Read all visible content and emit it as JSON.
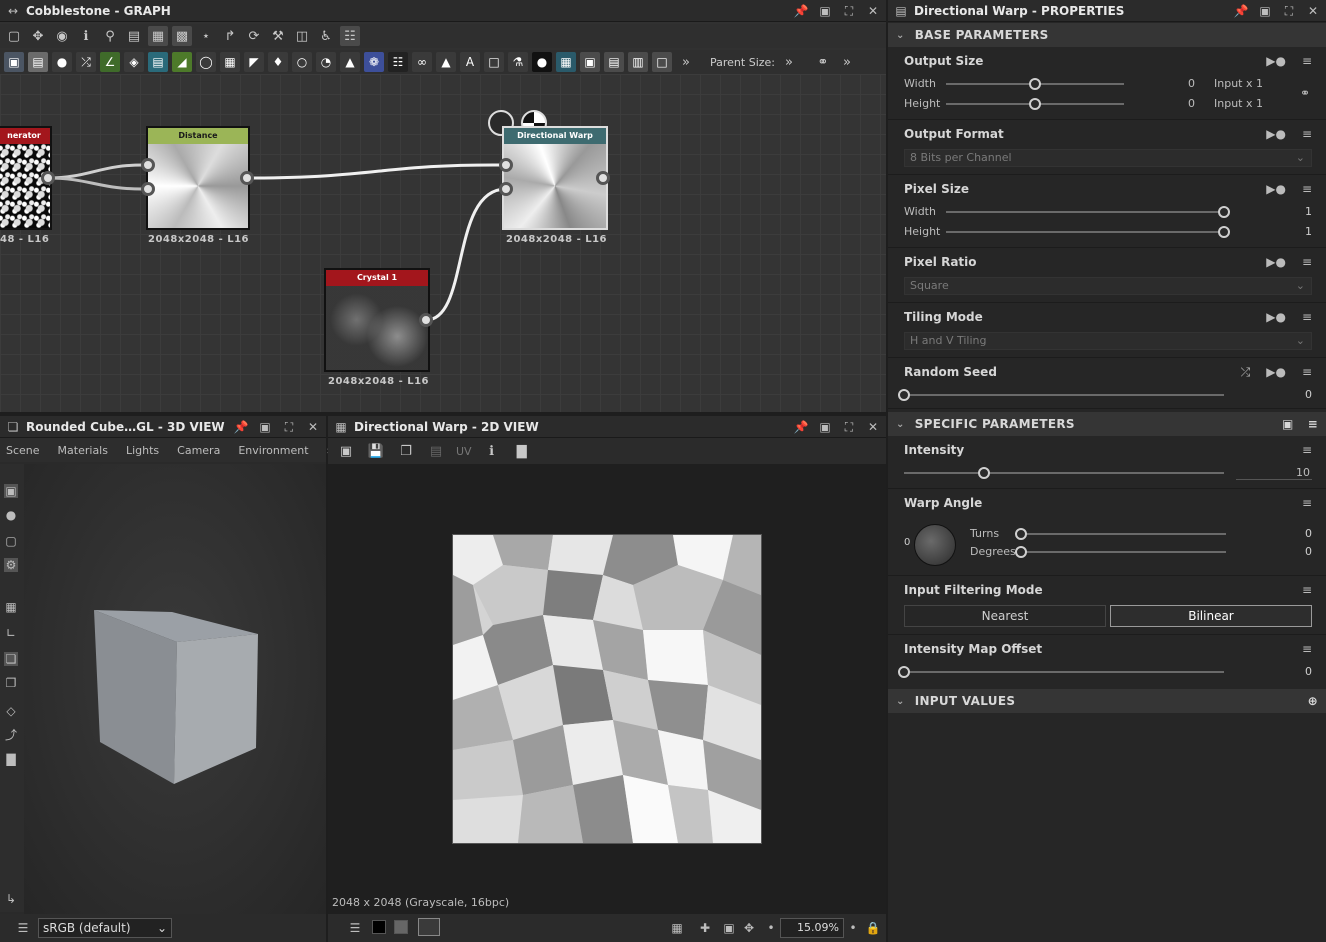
{
  "graph": {
    "title": "Cobblestone - GRAPH",
    "parent_size_label": "Parent Size:",
    "nodes": [
      {
        "id": "generator",
        "header": "nerator",
        "header_color": "#a3161c",
        "size_label": "48 - L16"
      },
      {
        "id": "distance",
        "header": "Distance",
        "header_color": "#9bb557",
        "size_label": "2048x2048 - L16"
      },
      {
        "id": "directional_warp",
        "header": "Directional Warp",
        "header_color": "#3e6b70",
        "size_label": "2048x2048 - L16"
      },
      {
        "id": "crystal",
        "header": "Crystal 1",
        "header_color": "#a3161c",
        "size_label": "2048x2048 - L16"
      }
    ]
  },
  "view3d": {
    "title": "Rounded Cube…GL - 3D VIEW",
    "tabs": [
      "Scene",
      "Materials",
      "Lights",
      "Camera",
      "Environment"
    ],
    "colorspace": "sRGB (default)"
  },
  "view2d": {
    "title": "Directional Warp - 2D VIEW",
    "uv_label": "UV",
    "status": "2048 x 2048 (Grayscale, 16bpc)",
    "zoom": "15.09%"
  },
  "props": {
    "title": "Directional Warp - PROPERTIES",
    "base_section": "BASE PARAMETERS",
    "output_size": {
      "label": "Output Size",
      "width_label": "Width",
      "width_value": "0",
      "width_suffix": "Input x 1",
      "height_label": "Height",
      "height_value": "0",
      "height_suffix": "Input x 1",
      "width_fraction": 0.5,
      "height_fraction": 0.5
    },
    "output_format": {
      "label": "Output Format",
      "value": "8 Bits per Channel"
    },
    "pixel_size": {
      "label": "Pixel Size",
      "width_label": "Width",
      "width_value": "1",
      "height_label": "Height",
      "height_value": "1",
      "width_fraction": 1.0,
      "height_fraction": 1.0
    },
    "pixel_ratio": {
      "label": "Pixel Ratio",
      "value": "Square"
    },
    "tiling_mode": {
      "label": "Tiling Mode",
      "value": "H and V Tiling"
    },
    "random_seed": {
      "label": "Random Seed",
      "value": "0",
      "fraction": 0.0
    },
    "specific_section": "SPECIFIC PARAMETERS",
    "intensity": {
      "label": "Intensity",
      "value": "10",
      "fraction": 0.25
    },
    "warp_angle": {
      "label": "Warp Angle",
      "dial_value": "0",
      "turns_label": "Turns",
      "turns_value": "0",
      "degrees_label": "Degrees",
      "degrees_value": "0"
    },
    "filtering": {
      "label": "Input Filtering Mode",
      "options": [
        "Nearest",
        "Bilinear"
      ],
      "selected": "Bilinear"
    },
    "intensity_map_offset": {
      "label": "Intensity Map Offset",
      "value": "0",
      "fraction": 0.0
    },
    "input_section": "INPUT VALUES"
  }
}
